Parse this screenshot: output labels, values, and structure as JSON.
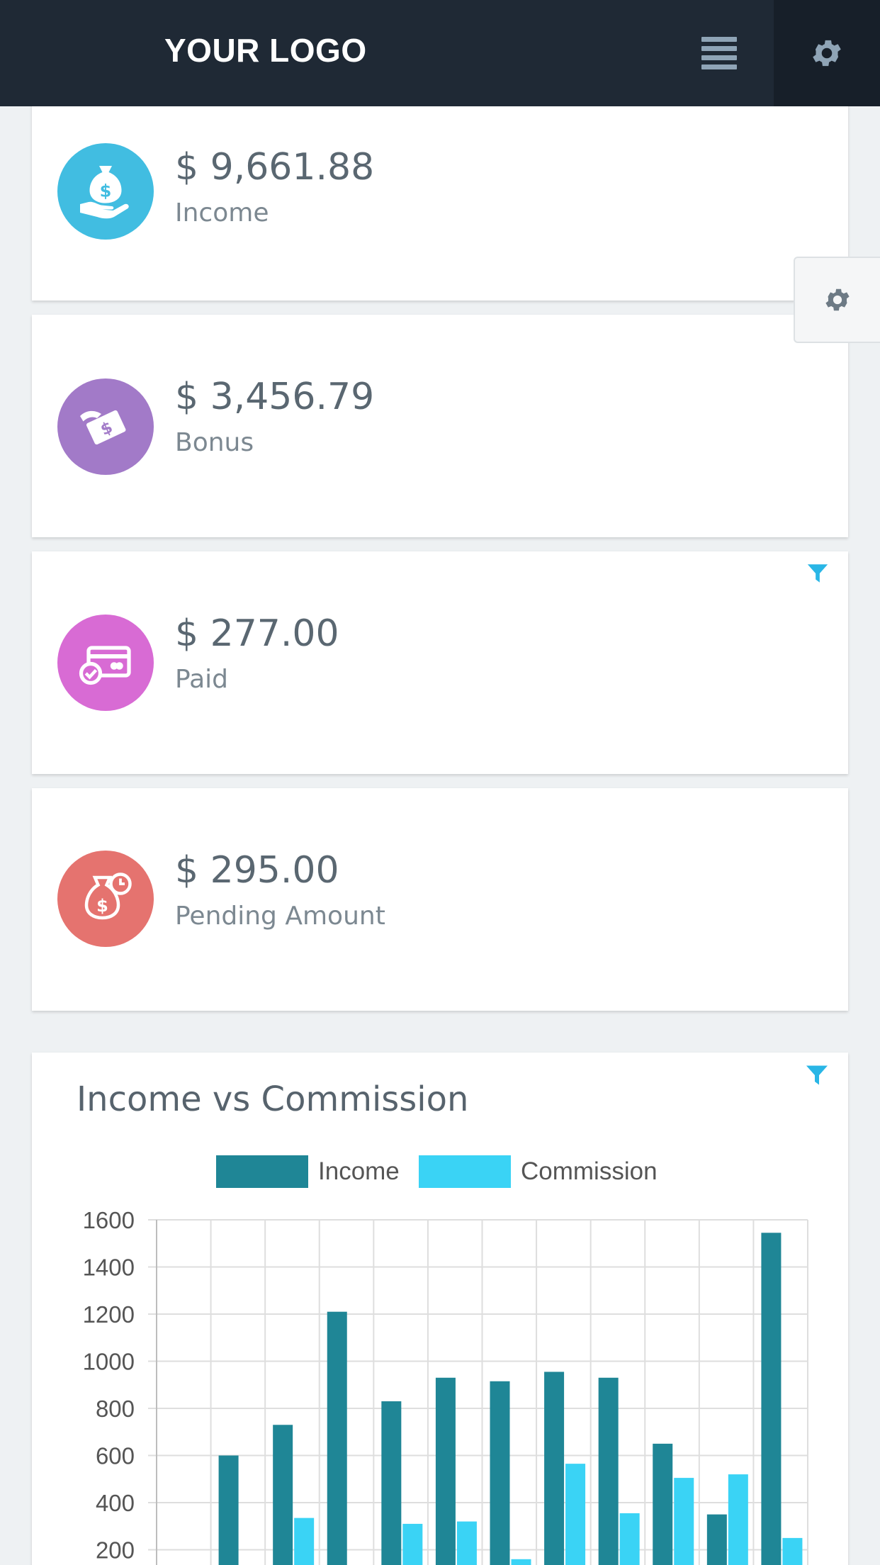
{
  "header": {
    "logo": "YOUR LOGO"
  },
  "stats": [
    {
      "value": "$ 9,661.88",
      "label": "Income",
      "color": "#41bde1",
      "icon": "money-bag-hand-icon"
    },
    {
      "value": "$ 3,456.79",
      "label": "Bonus",
      "color": "#a27ac8",
      "icon": "bonus-hand-bill-icon"
    },
    {
      "value": "$ 277.00",
      "label": "Paid",
      "color": "#d86bd4",
      "icon": "card-check-icon"
    },
    {
      "value": "$ 295.00",
      "label": "Pending Amount",
      "color": "#e5736f",
      "icon": "money-bag-clock-icon"
    }
  ],
  "colors": {
    "header_bg": "#1f2935",
    "accent": "#29b6e6",
    "income_bar": "#1f8696",
    "commission_bar": "#3ad3f5"
  },
  "chart": {
    "title": "Income vs Commission"
  },
  "chart_data": {
    "type": "bar",
    "title": "Income vs Commission",
    "legend_position": "top",
    "grid": true,
    "ylim": [
      0,
      1600
    ],
    "y_ticks": [
      "1600",
      "1400",
      "1200",
      "1000",
      "800",
      "600",
      "400",
      "200"
    ],
    "series": [
      {
        "name": "Income",
        "color": "#1f8696",
        "values": [
          600,
          730,
          1210,
          830,
          930,
          915,
          955,
          930,
          650,
          350,
          1545
        ]
      },
      {
        "name": "Commission",
        "color": "#3ad3f5",
        "values": [
          0,
          335,
          0,
          310,
          320,
          160,
          565,
          355,
          505,
          520,
          250
        ]
      }
    ]
  }
}
